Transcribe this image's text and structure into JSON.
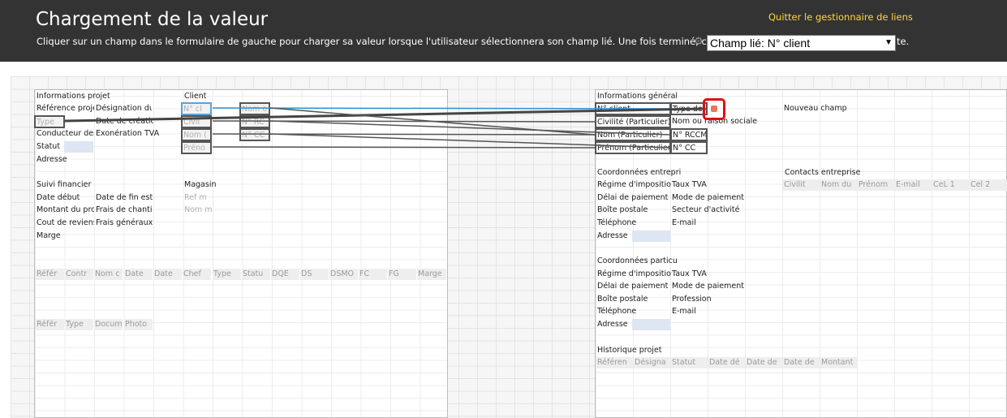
{
  "header": {
    "title": "Chargement de la valeur",
    "instruction": "Cliquer sur un champ dans le formulaire de gauche pour charger sa valeur lorsque l'utilisateur sélectionnera son champ lié. Une fois terminé, cliquer sur le lien",
    "instruction_end": "te.",
    "quit_link": "Quitter le gestionnaire de liens",
    "linked_field_select": "Champ lié: N° client"
  },
  "left_form": {
    "projet": {
      "title": "Informations projet",
      "reference": "Référence projet",
      "designation": "Désignation du",
      "type": "Type",
      "date_creation": "Date de créatio",
      "conducteur": "Conducteur des",
      "exoneration": "Exonération TVA",
      "statut": "Statut",
      "adresse": "Adresse"
    },
    "client": {
      "title": "Client",
      "num": "N° cl",
      "nom": "Nom o",
      "civil": "Civil",
      "rc": "N° RC",
      "nom_p": "Nom (",
      "cc": "N° CC",
      "prenom": "Préno"
    },
    "financier": {
      "title": "Suivi financier",
      "date_debut": "Date début",
      "date_fin": "Date de fin est",
      "montant": "Montant du pro",
      "frais_chantier": "Frais de chanti",
      "cout": "Cout de reviens",
      "frais_generaux": "Frais généraux",
      "marge": "Marge"
    },
    "magasin": {
      "title": "Magasin",
      "ref": "Ref m",
      "nom": "Nom m"
    },
    "table1_headers": [
      "Référ",
      "Contr",
      "Nom c",
      "Date",
      "Date",
      "Chef",
      "Type",
      "Statu",
      "DQE",
      "DS",
      "DSMO",
      "FC",
      "FG",
      "Marge"
    ],
    "table2_headers": [
      "Référ",
      "Type",
      "Docum",
      "Photo"
    ]
  },
  "right_form": {
    "general": {
      "title": "Informations général",
      "num_client": "N° client",
      "type_client": "Type de client",
      "nouveau": "Nouveau champ",
      "civilite": "Civilité (Particulier)",
      "nom_raison": "Nom ou raison sociale",
      "nom_part": "Nom (Particulier)",
      "rccm": "N° RCCM",
      "prenom_part": "Prénom (Particulier)",
      "cc": "N° CC"
    },
    "entreprise": {
      "title": "Coordonnées entrepri",
      "regime": "Régime d'imposition",
      "taux": "Taux TVA",
      "delai": "Délai de paiement",
      "mode": "Mode de paiement",
      "boite": "Boîte postale",
      "secteur": "Secteur d'activité",
      "telephone": "Téléphone",
      "email": "E-mail",
      "adresse": "Adresse"
    },
    "contacts": {
      "title": "Contacts entreprise",
      "headers": [
        "Civilit",
        "Nom du",
        "Prénom",
        "E-mail",
        "CeL 1",
        "Cel 2"
      ]
    },
    "particulier": {
      "title": "Coordonnées particu",
      "regime": "Régime d'imposition",
      "taux": "Taux TVA",
      "delai": "Délai de paiement",
      "mode": "Mode de paiement",
      "boite": "Boîte postale",
      "profession": "Profession",
      "telephone": "Téléphone",
      "email": "E-mail",
      "adresse": "Adresse"
    },
    "historique": {
      "title": "Historique projet",
      "headers": [
        "Référen",
        "Désigna",
        "Statut",
        "Date dé",
        "Date de",
        "Date de",
        "Montant"
      ]
    }
  },
  "colors": {
    "header_bg": "#333333",
    "link_yellow": "#ffd83a",
    "link_line_blue": "#2f8fd0",
    "link_line_dark": "#444444",
    "pin_red": "#e01010"
  },
  "icons": {
    "gear": "gear-icon",
    "chevron": "chevron-down-icon",
    "pin": "link-target-icon"
  }
}
